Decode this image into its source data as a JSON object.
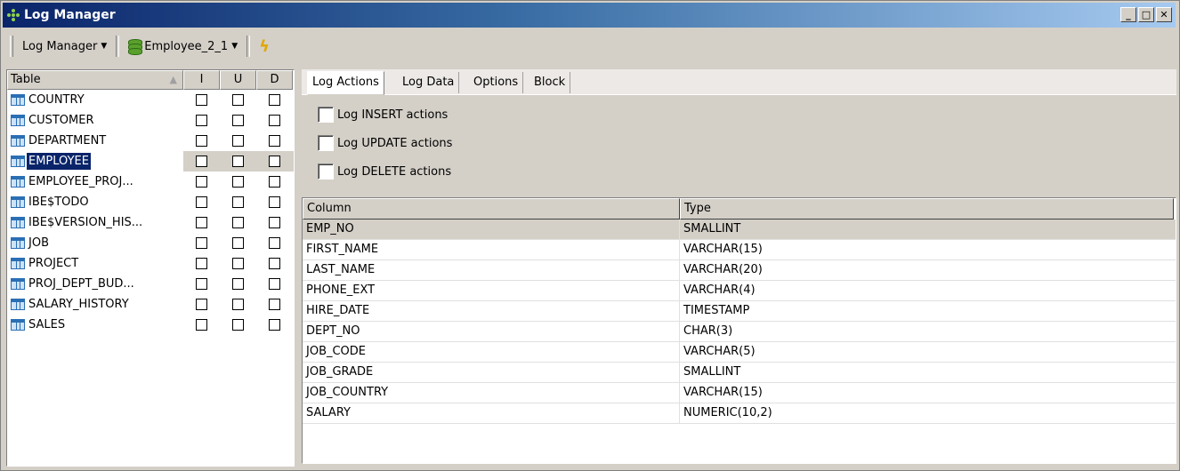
{
  "window": {
    "title": "Log Manager"
  },
  "window_controls": {
    "minimize": "_",
    "maximize": "□",
    "close": "✕"
  },
  "toolbar": {
    "log_manager": "Log Manager",
    "database": "Employee_2_1"
  },
  "left_panel": {
    "headers": {
      "table": "Table",
      "i": "I",
      "u": "U",
      "d": "D"
    },
    "rows": [
      {
        "name": "COUNTRY"
      },
      {
        "name": "CUSTOMER"
      },
      {
        "name": "DEPARTMENT"
      },
      {
        "name": "EMPLOYEE",
        "selected": true
      },
      {
        "name": "EMPLOYEE_PROJ..."
      },
      {
        "name": "IBE$TODO"
      },
      {
        "name": "IBE$VERSION_HIS..."
      },
      {
        "name": "JOB"
      },
      {
        "name": "PROJECT"
      },
      {
        "name": "PROJ_DEPT_BUD..."
      },
      {
        "name": "SALARY_HISTORY"
      },
      {
        "name": "SALES"
      }
    ]
  },
  "tabs": [
    "Log Actions",
    "Log Data",
    "Options",
    "Block"
  ],
  "options": {
    "insert": "Log INSERT actions",
    "update": "Log UPDATE actions",
    "delete": "Log DELETE actions"
  },
  "grid": {
    "headers": {
      "column": "Column",
      "type": "Type"
    },
    "rows": [
      {
        "column": "EMP_NO",
        "type": "SMALLINT"
      },
      {
        "column": "FIRST_NAME",
        "type": "VARCHAR(15)"
      },
      {
        "column": "LAST_NAME",
        "type": "VARCHAR(20)"
      },
      {
        "column": "PHONE_EXT",
        "type": "VARCHAR(4)"
      },
      {
        "column": "HIRE_DATE",
        "type": "TIMESTAMP"
      },
      {
        "column": "DEPT_NO",
        "type": "CHAR(3)"
      },
      {
        "column": "JOB_CODE",
        "type": "VARCHAR(5)"
      },
      {
        "column": "JOB_GRADE",
        "type": "SMALLINT"
      },
      {
        "column": "JOB_COUNTRY",
        "type": "VARCHAR(15)"
      },
      {
        "column": "SALARY",
        "type": "NUMERIC(10,2)"
      }
    ]
  },
  "colors": {
    "title_start": "#0a246a",
    "title_end": "#a6caf0",
    "selection": "#0a246a",
    "chrome": "#d4d0c8"
  }
}
